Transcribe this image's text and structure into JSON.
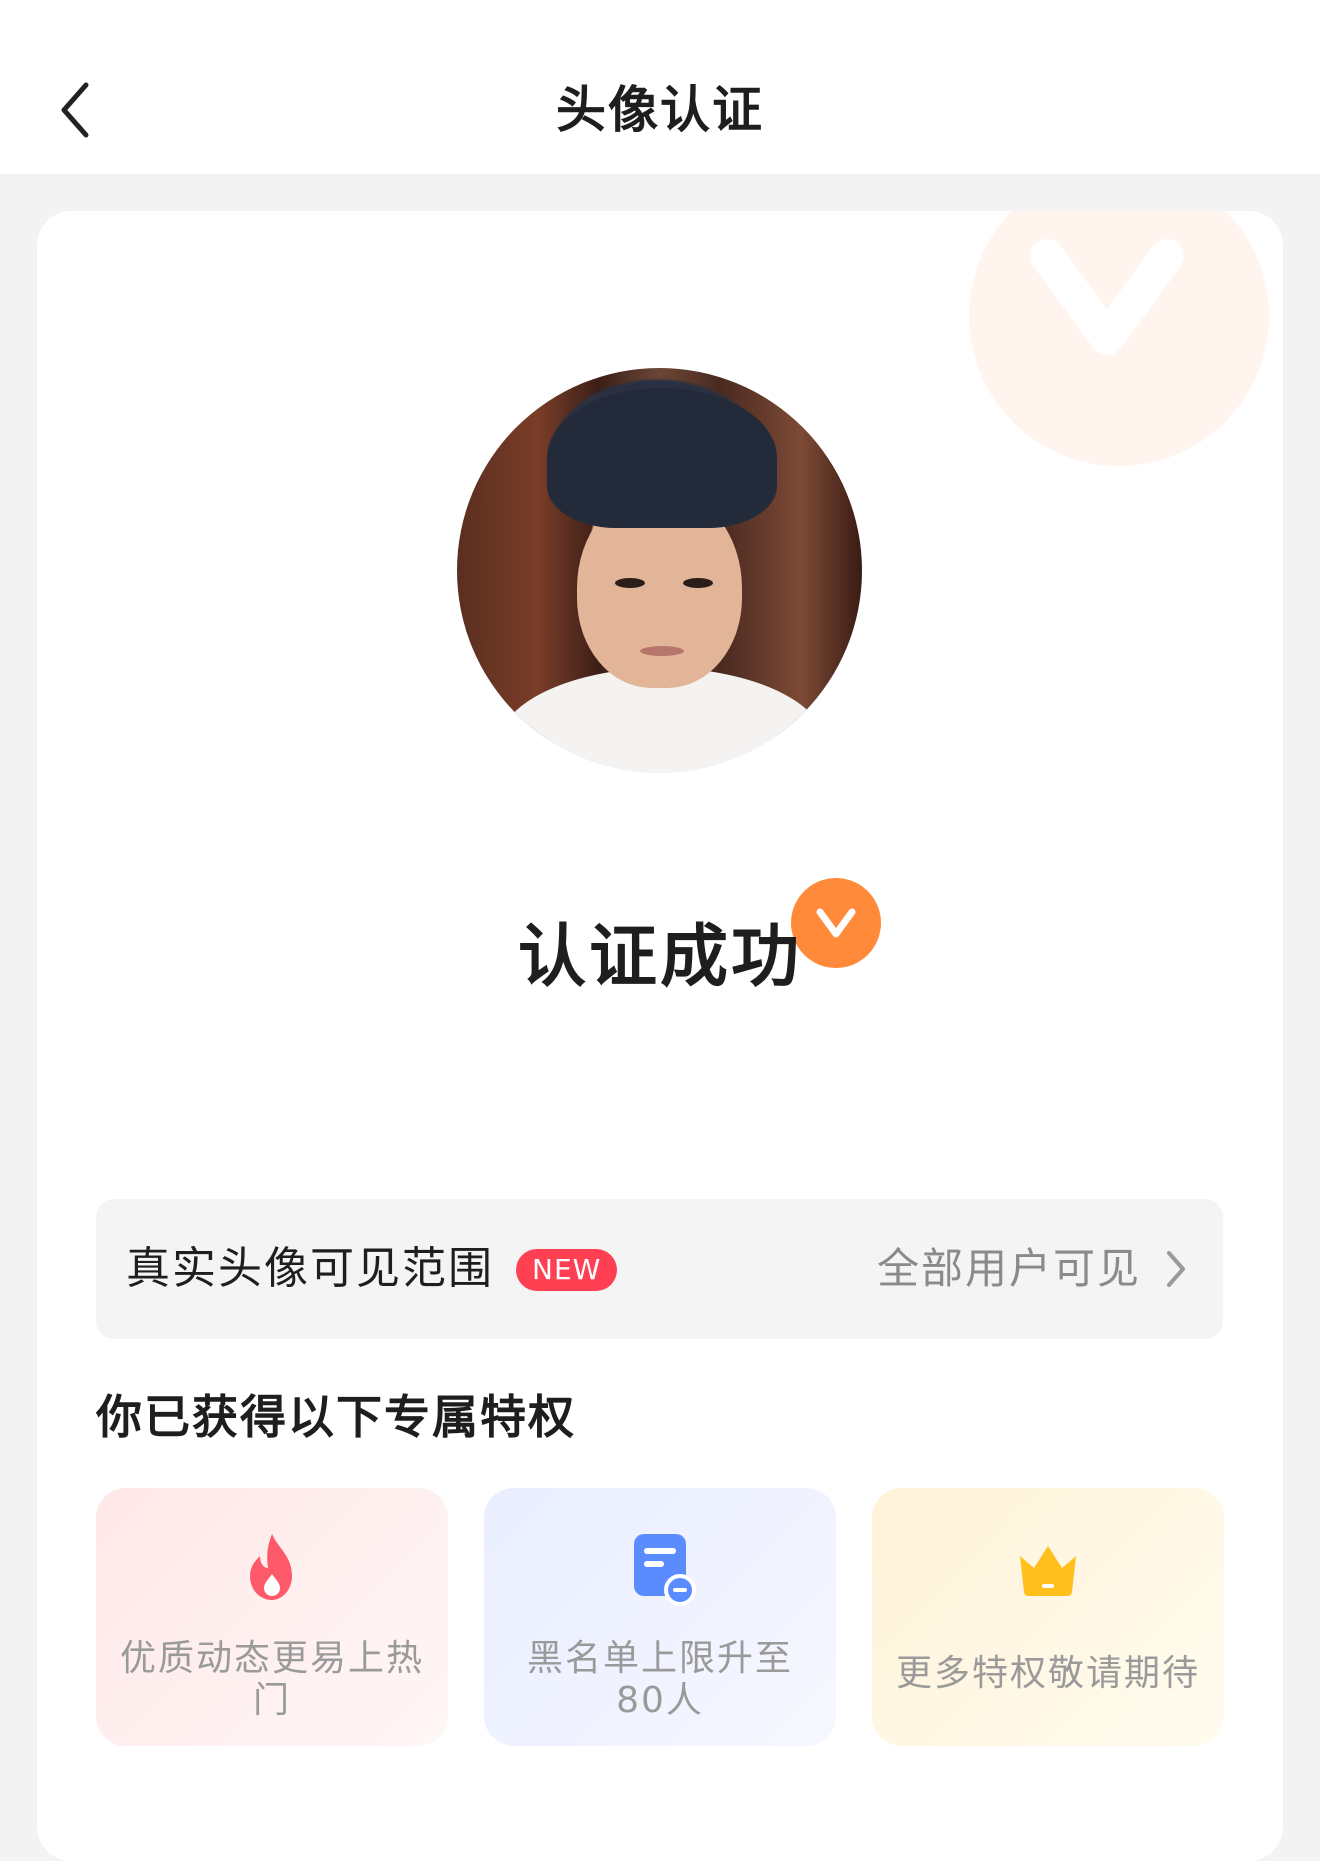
{
  "header": {
    "title": "头像认证"
  },
  "status": {
    "title": "认证成功"
  },
  "visibility": {
    "label": "真实头像可见范围",
    "badge": "NEW",
    "value": "全部用户可见"
  },
  "privileges": {
    "title": "你已获得以下专属特权",
    "items": [
      {
        "text": "优质动态更易上热门",
        "icon": "flame-icon"
      },
      {
        "text": "黑名单上限升至80人",
        "icon": "list-minus-icon"
      },
      {
        "text": "更多特权敬请期待",
        "icon": "crown-icon"
      }
    ]
  },
  "colors": {
    "accent": "#ff8a3a",
    "new_badge": "#ff3f52"
  }
}
